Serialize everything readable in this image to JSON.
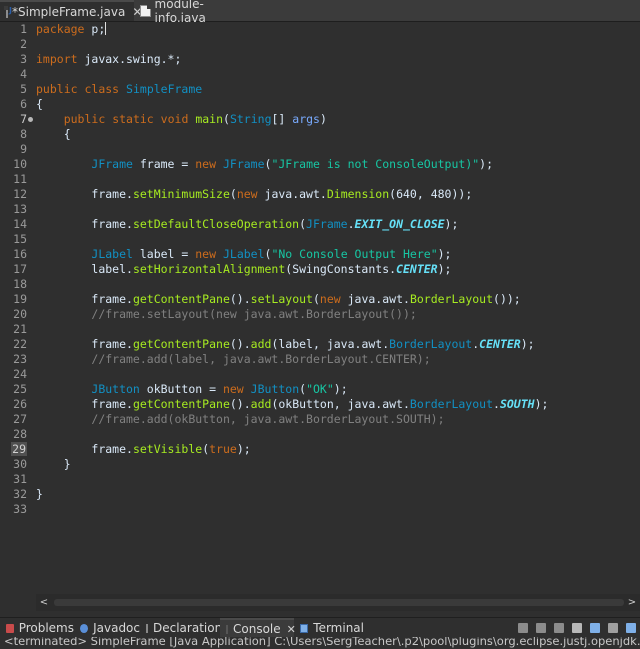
{
  "editor_tabs": [
    {
      "label": "*SimpleFrame.java",
      "close": "✕"
    },
    {
      "label": "module-info.java"
    }
  ],
  "code_lines": [
    {
      "n": "1"
    },
    {
      "n": "2"
    },
    {
      "n": "3"
    },
    {
      "n": "4"
    },
    {
      "n": "5"
    },
    {
      "n": "6"
    },
    {
      "n": "7"
    },
    {
      "n": "8"
    },
    {
      "n": "9"
    },
    {
      "n": "10"
    },
    {
      "n": "11"
    },
    {
      "n": "12"
    },
    {
      "n": "13"
    },
    {
      "n": "14"
    },
    {
      "n": "15"
    },
    {
      "n": "16"
    },
    {
      "n": "17"
    },
    {
      "n": "18"
    },
    {
      "n": "19"
    },
    {
      "n": "20"
    },
    {
      "n": "21"
    },
    {
      "n": "22"
    },
    {
      "n": "23"
    },
    {
      "n": "24"
    },
    {
      "n": "25"
    },
    {
      "n": "26"
    },
    {
      "n": "27"
    },
    {
      "n": "28"
    },
    {
      "n": "29"
    },
    {
      "n": "30"
    },
    {
      "n": "31"
    },
    {
      "n": "32"
    },
    {
      "n": "33"
    }
  ],
  "code": {
    "l1": [
      "package",
      " p;"
    ],
    "l3": [
      "import",
      " javax.swing.*;"
    ],
    "l5": [
      "public",
      " ",
      "class",
      " ",
      "SimpleFrame"
    ],
    "l6": "{",
    "l7": [
      "public",
      "static",
      "void",
      "main",
      "(",
      "String",
      "[] ",
      "args",
      ")"
    ],
    "l8": "{",
    "l10": [
      "JFrame",
      " frame = ",
      "new",
      " ",
      "JFrame",
      "(",
      "\"JFrame is not ConsoleOutput)\"",
      ");"
    ],
    "l12": [
      "frame.",
      "setMinimumSize",
      "(",
      "new",
      " java.awt.",
      "Dimension",
      "(640, 480));"
    ],
    "l14": [
      "frame.",
      "setDefaultCloseOperation",
      "(",
      "JFrame",
      ".",
      "EXIT_ON_CLOSE",
      ");"
    ],
    "l16": [
      "JLabel",
      " label = ",
      "new",
      " ",
      "JLabel",
      "(",
      "\"No Console Output Here\"",
      ");"
    ],
    "l17": [
      "label.",
      "setHorizontalAlignment",
      "(SwingConstants.",
      "CENTER",
      ");"
    ],
    "l19": [
      "frame.",
      "getContentPane",
      "().",
      "setLayout",
      "(",
      "new",
      " java.awt.",
      "BorderLayout",
      "());"
    ],
    "l20": "//frame.setLayout(new java.awt.BorderLayout());",
    "l22": [
      "frame.",
      "getContentPane",
      "().",
      "add",
      "(label, java.awt.",
      "BorderLayout",
      ".",
      "CENTER",
      ");"
    ],
    "l23": "//frame.add(label, java.awt.BorderLayout.CENTER);",
    "l25": [
      "JButton",
      " okButton = ",
      "new",
      " ",
      "JButton",
      "(",
      "\"OK\"",
      ");"
    ],
    "l26": [
      "frame.",
      "getContentPane",
      "().",
      "add",
      "(okButton, java.awt.",
      "BorderLayout",
      ".",
      "SOUTH",
      ");"
    ],
    "l27": "//frame.add(okButton, java.awt.BorderLayout.SOUTH);",
    "l29": [
      "frame.",
      "setVisible",
      "(",
      "true",
      ");"
    ],
    "l30": "}",
    "l32": "}"
  },
  "view_tabs": [
    {
      "label": "Problems"
    },
    {
      "label": "Javadoc"
    },
    {
      "label": "Declaration"
    },
    {
      "label": "Console",
      "close": "✕"
    },
    {
      "label": "Terminal"
    }
  ],
  "console_text": "<terminated> SimpleFrame [Java Application] C:\\Users\\SergTeacher\\.p2\\pool\\plugins\\org.eclipse.justj.openjdk.hotspot.jre.full.w",
  "scroll": {
    "left": "<",
    "right": ">"
  },
  "colors": {
    "keyword": "#cc6c1d",
    "type": "#1290c3",
    "string": "#17c6a3",
    "method": "#a7ec21",
    "comment": "#808080",
    "constant": "#66e1f8",
    "background": "#2f2f2f"
  }
}
